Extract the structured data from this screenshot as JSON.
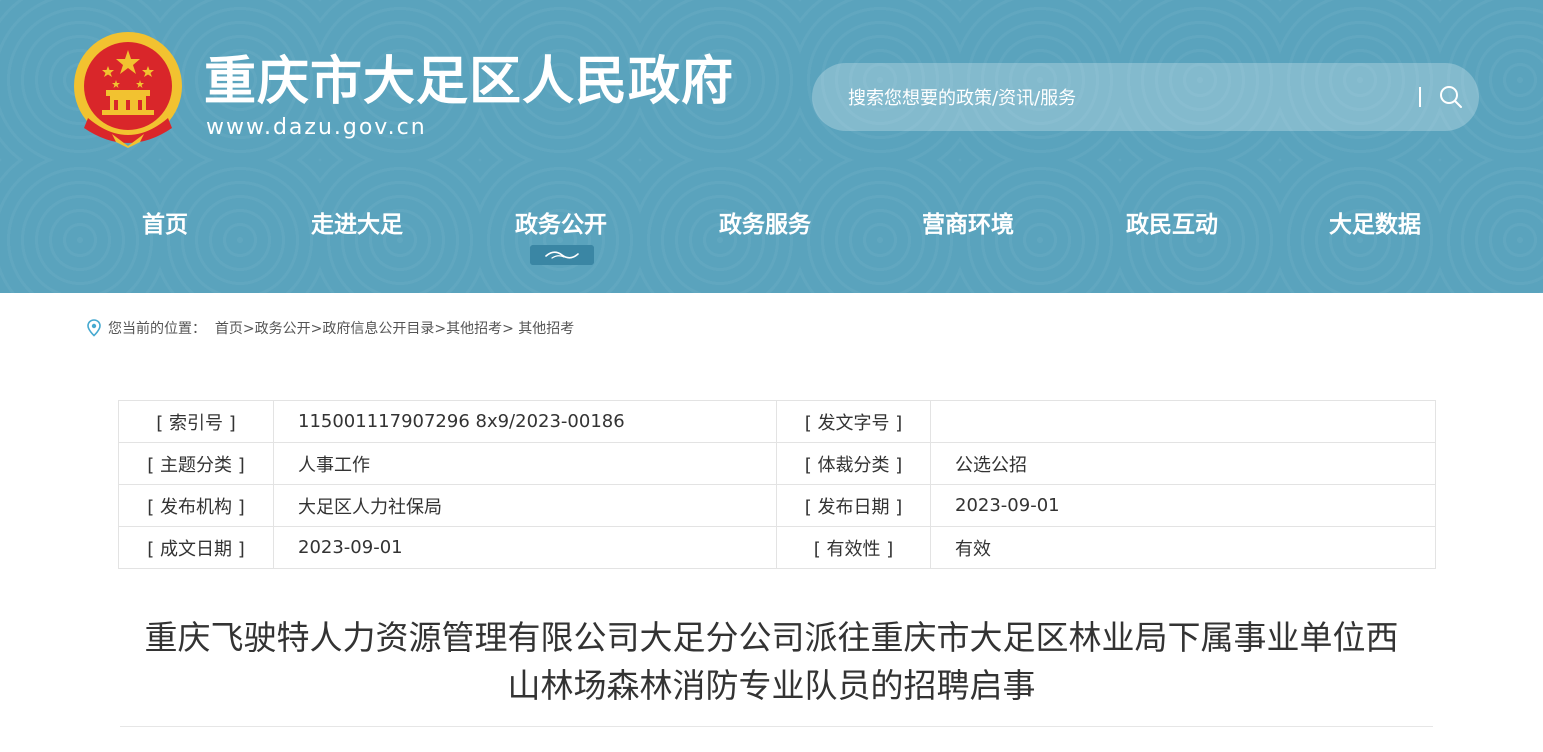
{
  "header": {
    "site_title": "重庆市大足区人民政府",
    "site_url": "www.dazu.gov.cn",
    "search_placeholder": "搜索您想要的政策/资讯/服务",
    "nav": [
      {
        "label": "首页"
      },
      {
        "label": "走进大足"
      },
      {
        "label": "政务公开",
        "active": true
      },
      {
        "label": "政务服务"
      },
      {
        "label": "营商环境"
      },
      {
        "label": "政民互动"
      },
      {
        "label": "大足数据"
      }
    ]
  },
  "breadcrumb": {
    "prefix": "您当前的位置：",
    "items": [
      "首页",
      ">政务公开",
      ">政府信息公开目录",
      ">其他招考",
      "> 其他招考"
    ]
  },
  "meta": {
    "rows": [
      {
        "label1": "[ 索引号 ]",
        "value1": "115001117907296 8x9/2023-00186",
        "label2": "[ 发文字号 ]",
        "value2": ""
      },
      {
        "label1": "[ 主题分类 ]",
        "value1": "人事工作",
        "label2": "[ 体裁分类 ]",
        "value2": "公选公招"
      },
      {
        "label1": "[ 发布机构 ]",
        "value1": "大足区人力社保局",
        "label2": "[ 发布日期 ]",
        "value2": "2023-09-01"
      },
      {
        "label1": "[ 成文日期 ]",
        "value1": "2023-09-01",
        "label2": "[ 有效性 ]",
        "value2": "有效"
      }
    ]
  },
  "article": {
    "title_line1": "重庆飞驶特人力资源管理有限公司大足分公司派往重庆市大足区林业局下属事业单位西",
    "title_line2": "山林场森林消防专业队员的招聘启事"
  },
  "colors": {
    "header_bg": "#5aa3bd",
    "nav_active_mark": "#3a86a4",
    "emblem_red": "#d9262a",
    "emblem_gold": "#f2c230"
  },
  "icons": {
    "emblem": "national-emblem-icon",
    "search": "search-icon",
    "breadcrumb": "location-pin-icon"
  }
}
